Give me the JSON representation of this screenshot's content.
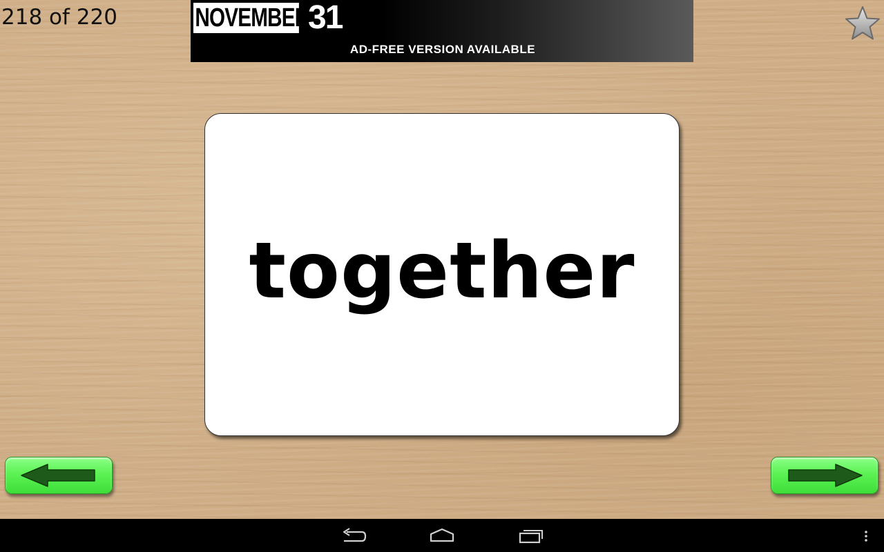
{
  "counter": {
    "text": "218 of 220"
  },
  "ad": {
    "logo_month": "NOVEMBER",
    "logo_day": "31",
    "tagline": "AD-FREE VERSION AVAILABLE"
  },
  "card": {
    "word": "together"
  },
  "icons": {
    "favorite": "star-icon",
    "previous": "left-arrow-icon",
    "next": "right-arrow-icon",
    "system_back": "back-icon",
    "system_home": "home-icon",
    "system_recents": "recents-icon",
    "system_menu": "overflow-menu-icon"
  },
  "colors": {
    "button_green": "#5cf254",
    "arrow_green": "#1e5a1a",
    "card_background": "#ffffff",
    "wood_background": "#cfae87"
  }
}
